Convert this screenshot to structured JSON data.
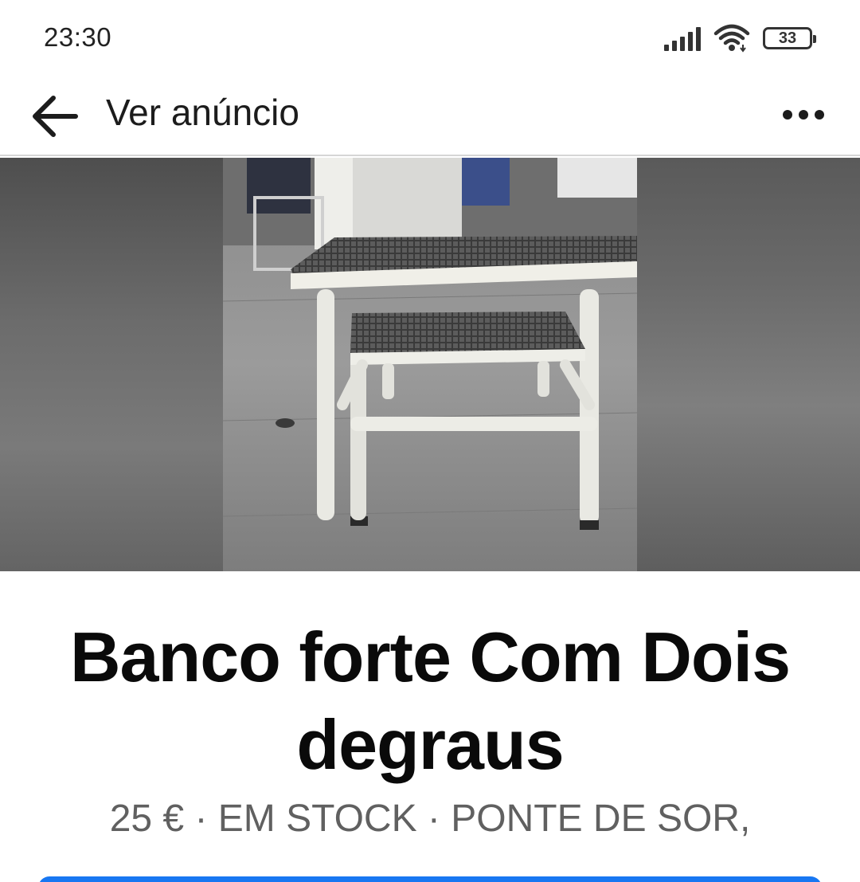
{
  "status_bar": {
    "time": "23:30",
    "battery": "33",
    "icons": [
      "signal-icon",
      "wifi-icon",
      "battery-icon"
    ]
  },
  "header": {
    "back_icon": "back-arrow-icon",
    "title": "Ver anúncio",
    "more_icon": "more-options-icon"
  },
  "listing": {
    "title": "Banco forte Com Dois degraus",
    "meta": "25 € · EM STOCK · PONTE DE SOR,",
    "photo_subject": "two-step-stool-photo"
  },
  "colors": {
    "accent": "#1877f2",
    "meta_text": "#606060",
    "divider": "#d6d6d6"
  }
}
